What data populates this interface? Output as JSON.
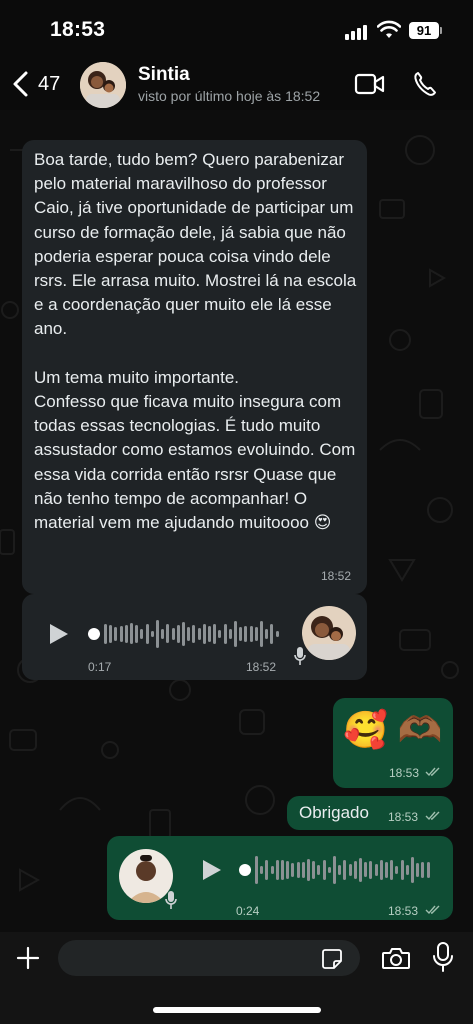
{
  "status_bar": {
    "time": "18:53",
    "battery": "91"
  },
  "header": {
    "back_count": "47",
    "contact_name": "Sintia",
    "last_seen": "visto por último hoje às 18:52"
  },
  "messages": {
    "incoming_text": {
      "text": "Boa tarde, tudo bem? Quero parabenizar pelo material maravilhoso do professor Caio, já tive oportunidade de participar um curso de formação dele, já sabia que não poderia esperar pouca coisa vindo dele rsrs. Ele arrasa muito. Mostrei lá na escola e a coordenação quer muito ele lá esse ano.\n\nUm tema muito importante.\nConfesso que ficava muito insegura com todas essas tecnologias. É tudo muito assustador como estamos evoluindo. Com essa vida corrida então rsrsr Quase que não tenho tempo de acompanhar! O material vem me ajudando muitoooo 😍",
      "time": "18:52"
    },
    "incoming_audio": {
      "duration": "0:17",
      "time": "18:52"
    },
    "outgoing_emoji": {
      "text": "🥰 🫶🏾",
      "time": "18:53"
    },
    "outgoing_text": {
      "text": "Obrigado",
      "time": "18:53"
    },
    "outgoing_audio": {
      "duration": "0:24",
      "time": "18:53"
    }
  },
  "colors": {
    "incoming_bubble": "#1f2326",
    "outgoing_bubble": "#0f4d34",
    "background": "#0b0b0b",
    "read_ticks": "#9fbfae"
  },
  "icons": [
    "back-chevron-icon",
    "video-call-icon",
    "phone-icon",
    "play-icon",
    "mic-icon",
    "plus-icon",
    "sticker-icon",
    "camera-icon",
    "double-check-icon"
  ]
}
